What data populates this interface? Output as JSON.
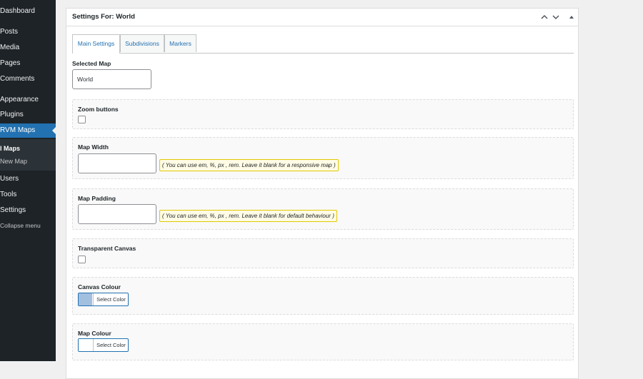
{
  "sidebar": {
    "items": [
      {
        "label": "Dashboard"
      },
      {
        "label": "Posts"
      },
      {
        "label": "Media"
      },
      {
        "label": "Pages"
      },
      {
        "label": "Comments"
      },
      {
        "label": "Appearance"
      },
      {
        "label": "Plugins"
      },
      {
        "label": "RVM Maps"
      },
      {
        "label": "Users"
      },
      {
        "label": "Tools"
      },
      {
        "label": "Settings"
      }
    ],
    "submenu": [
      "l Maps",
      "New Map"
    ],
    "collapse": "Collapse menu"
  },
  "panel": {
    "title": "Settings For: World",
    "tabs": [
      {
        "label": "Main Settings"
      },
      {
        "label": "Subdivisions"
      },
      {
        "label": "Markers"
      }
    ],
    "selected_map": {
      "label": "Selected Map",
      "value": "World"
    },
    "zoom_buttons": {
      "label": "Zoom buttons"
    },
    "map_width": {
      "label": "Map Width",
      "value": "",
      "hint": "( You can use em, %, px , rem. Leave it blank for a responsive map )"
    },
    "map_padding": {
      "label": "Map Padding",
      "value": "",
      "hint": "( You can use em, %, px , rem. Leave it blank for default behaviour )"
    },
    "transparent_canvas": {
      "label": "Transparent Canvas"
    },
    "canvas_colour": {
      "label": "Canvas Colour",
      "button": "Select Color",
      "swatch": "#a3bfe0"
    },
    "map_colour": {
      "label": "Map Colour",
      "button": "Select Color",
      "swatch": "#ffffff"
    }
  },
  "colors": {
    "accent": "#2271b1",
    "sidebar_bg": "#1d2327"
  }
}
